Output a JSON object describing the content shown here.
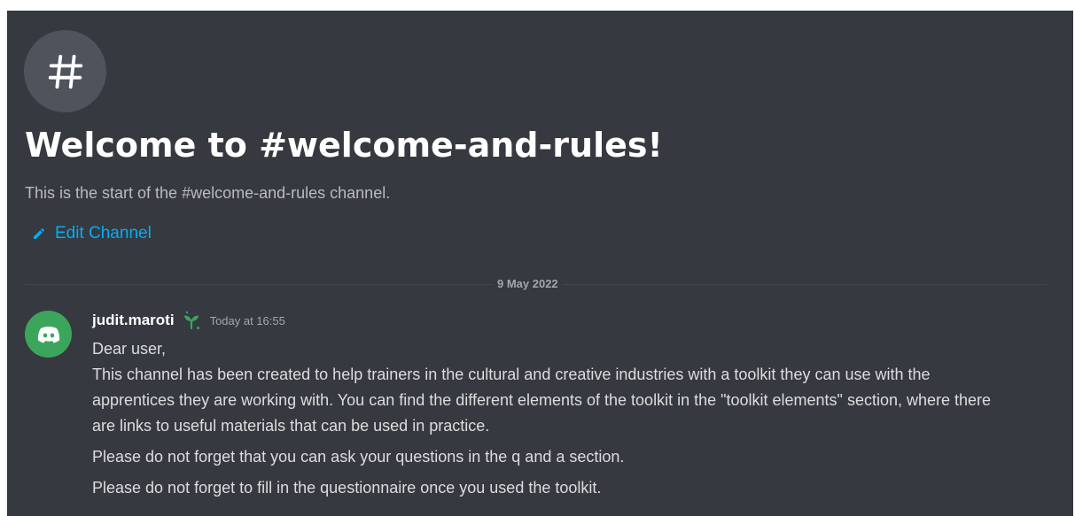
{
  "channel": {
    "welcome_title": "Welcome to #welcome-and-rules!",
    "welcome_subtitle": "This is the start of the #welcome-and-rules channel.",
    "edit_label": "Edit Channel",
    "icon": "hash-icon"
  },
  "divider": {
    "date": "9 May 2022"
  },
  "message": {
    "author": "judit.maroti",
    "badge_icon": "sprout-icon",
    "timestamp": "Today at 16:55",
    "lines": [
      "Dear user,",
      "This channel has been created to help trainers in the cultural and creative industries with a toolkit they can use with the apprentices they are working with. You can find the different elements of the toolkit in the \"toolkit elements\" section, where there are links to useful materials that can be used in practice.",
      "Please do not forget that you can ask your questions in the q and a section.",
      "Please do not forget to fill in the questionnaire once you used the toolkit."
    ]
  },
  "colors": {
    "background": "#36393f",
    "link": "#00aff4",
    "avatar": "#3ba55c",
    "badge": "#3ba55c"
  }
}
